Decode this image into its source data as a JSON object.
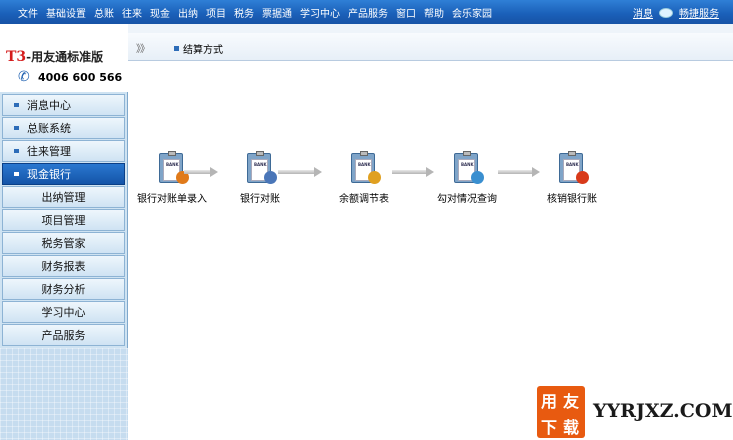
{
  "menubar": {
    "items": [
      "文件",
      "基础设置",
      "总账",
      "往来",
      "现金",
      "出纳",
      "项目",
      "税务",
      "票据通",
      "学习中心",
      "产品服务",
      "窗口",
      "帮助",
      "会乐家园"
    ],
    "message_label": "消息",
    "help_label": "畅捷服务"
  },
  "brand": {
    "title_prefix": "T3",
    "title_rest": "-用友通标准版",
    "phone": "4006 600 566"
  },
  "sidebar": {
    "items": [
      {
        "label": "消息中心"
      },
      {
        "label": "总账系统"
      },
      {
        "label": "往来管理"
      },
      {
        "label": "现金银行"
      }
    ],
    "subitems": [
      {
        "label": "出纳管理"
      },
      {
        "label": "项目管理"
      },
      {
        "label": "税务管家"
      },
      {
        "label": "财务报表"
      },
      {
        "label": "财务分析"
      },
      {
        "label": "学习中心"
      },
      {
        "label": "产品服务"
      }
    ]
  },
  "tabbar": {
    "chevron": "》》",
    "tab_label": "结算方式"
  },
  "flow": {
    "nodes": [
      {
        "label": "银行对账单录入",
        "accent": "#e07a1a"
      },
      {
        "label": "银行对账",
        "accent": "#4a76b8"
      },
      {
        "label": "余额调节表",
        "accent": "#e0a020"
      },
      {
        "label": "勾对情况查询",
        "accent": "#3a8fd0"
      },
      {
        "label": "核销银行账",
        "accent": "#d83a1a"
      }
    ]
  },
  "watermark": {
    "seal_chars": [
      "用",
      "友",
      "下",
      "载"
    ],
    "site": "YYRJXZ.COM"
  }
}
